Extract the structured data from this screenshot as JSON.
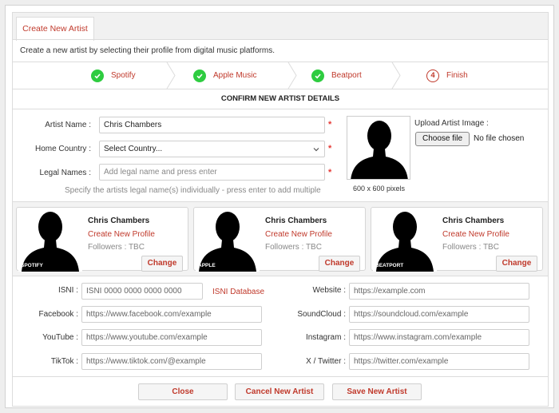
{
  "tab": {
    "label": "Create New Artist"
  },
  "intro": "Create a new artist by selecting their profile from digital music platforms.",
  "steps": [
    {
      "label": "Spotify",
      "state": "done"
    },
    {
      "label": "Apple Music",
      "state": "done"
    },
    {
      "label": "Beatport",
      "state": "done"
    },
    {
      "label": "Finish",
      "state": "current",
      "number": "4"
    }
  ],
  "section_title": "CONFIRM NEW ARTIST DETAILS",
  "form": {
    "artist_name_label": "Artist Name :",
    "artist_name_value": "Chris Chambers",
    "home_country_label": "Home Country :",
    "home_country_value": "Select Country...",
    "legal_names_label": "Legal Names :",
    "legal_names_placeholder": "Add legal name and press enter",
    "required_mark": "*",
    "hint": "Specify the artists legal name(s) individually - press enter to add multiple"
  },
  "upload": {
    "label": "Upload Artist Image :",
    "button": "Choose file",
    "status": "No file chosen",
    "size_note": "600 x 600 pixels"
  },
  "platforms": [
    {
      "tag": "SPOTIFY",
      "name": "Chris Chambers",
      "link": "Create New Profile",
      "followers": "Followers : TBC",
      "button": "Change"
    },
    {
      "tag": "APPLE",
      "name": "Chris Chambers",
      "link": "Create New Profile",
      "followers": "Followers : TBC",
      "button": "Change"
    },
    {
      "tag": "BEATPORT",
      "name": "Chris Chambers",
      "link": "Create New Profile",
      "followers": "Followers : TBC",
      "button": "Change"
    }
  ],
  "links": {
    "isni_label": "ISNI :",
    "isni_placeholder": "ISNI 0000 0000 0000 0000",
    "isni_link": "ISNI Database",
    "facebook_label": "Facebook :",
    "facebook_placeholder": "https://www.facebook.com/example",
    "youtube_label": "YouTube :",
    "youtube_placeholder": "https://www.youtube.com/example",
    "tiktok_label": "TikTok :",
    "tiktok_placeholder": "https://www.tiktok.com/@example",
    "website_label": "Website :",
    "website_placeholder": "https://example.com",
    "soundcloud_label": "SoundCloud :",
    "soundcloud_placeholder": "https://soundcloud.com/example",
    "instagram_label": "Instagram :",
    "instagram_placeholder": "https://www.instagram.com/example",
    "twitter_label": "X / Twitter :",
    "twitter_placeholder": "https://twitter.com/example"
  },
  "footer": {
    "close": "Close",
    "cancel": "Cancel New Artist",
    "save": "Save New Artist"
  },
  "colors": {
    "accent": "#c0392b",
    "check": "#2ecc40",
    "required": "#e53935"
  }
}
